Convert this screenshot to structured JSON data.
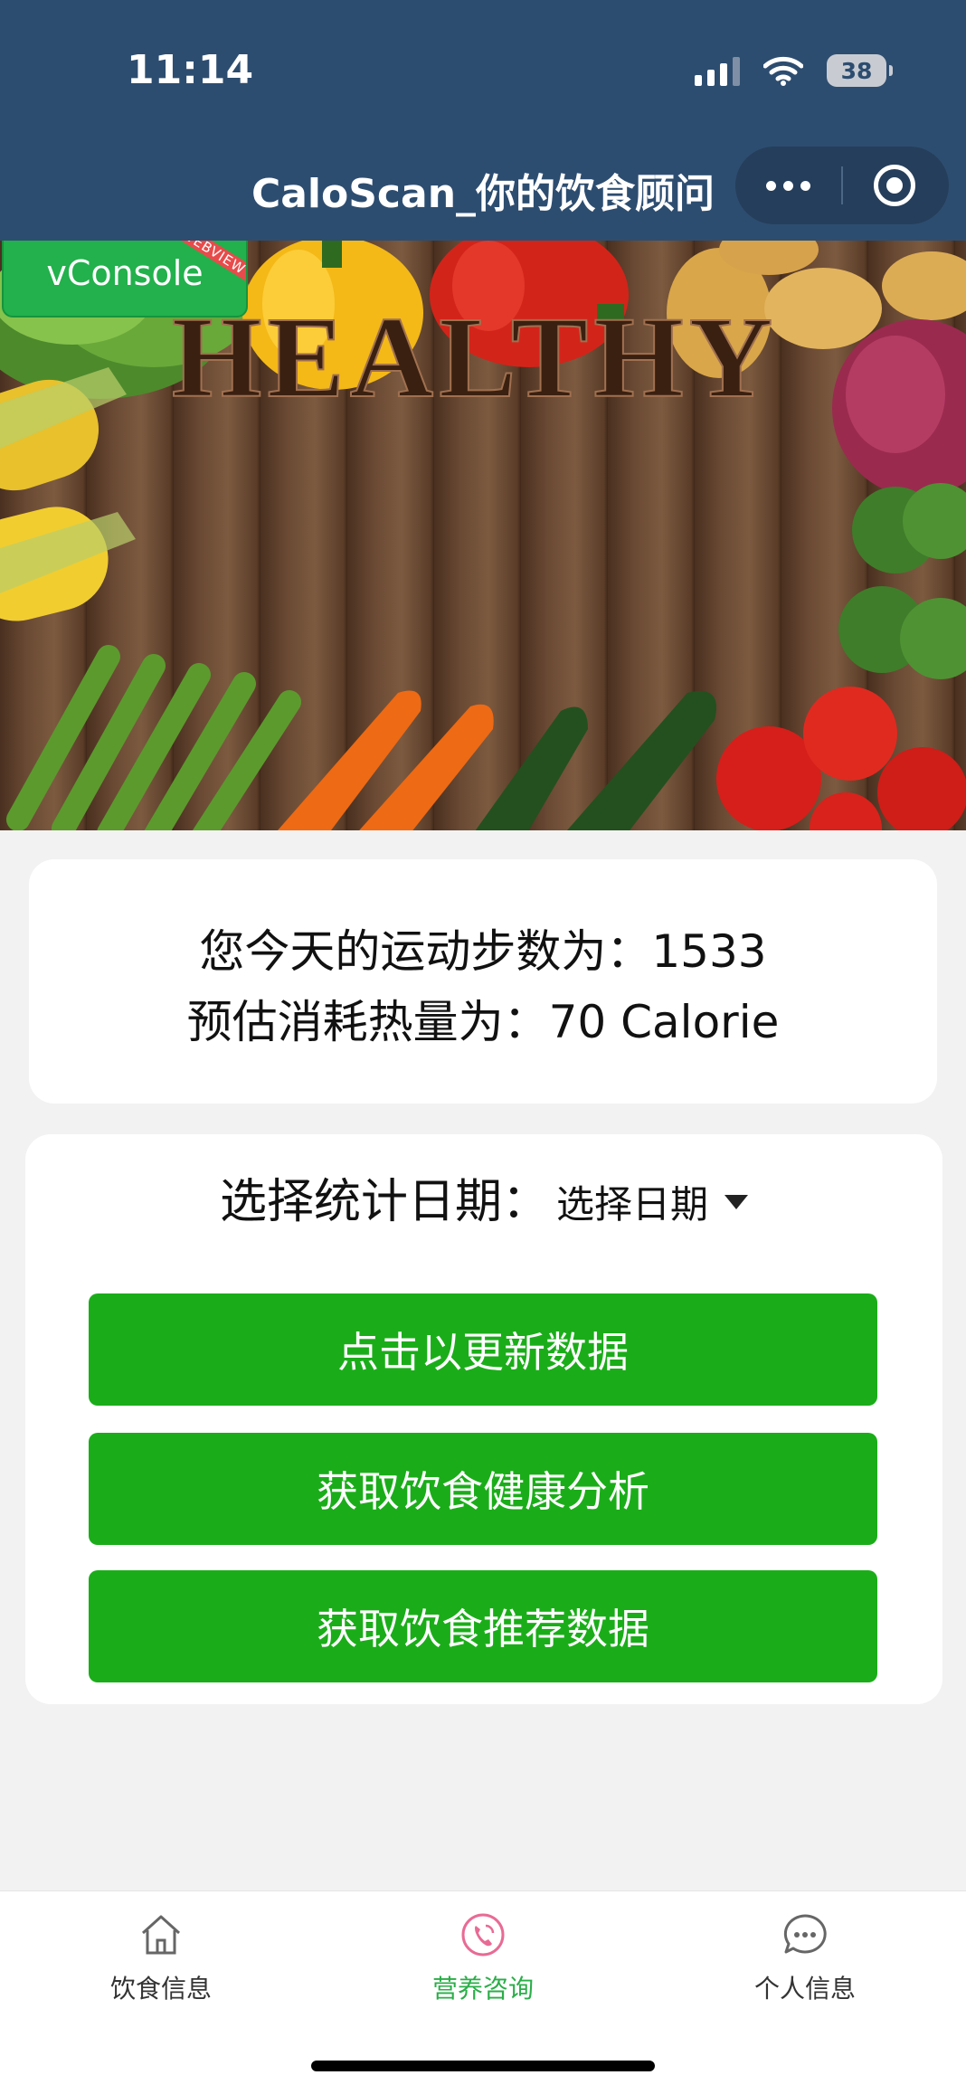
{
  "status_bar": {
    "time": "11:14",
    "battery": "38"
  },
  "nav": {
    "title": "CaloScan_你的饮食顾问"
  },
  "banner": {
    "text": "HEALTHY"
  },
  "vconsole": {
    "label": "vConsole",
    "ribbon": "WEBVIEW"
  },
  "steps": {
    "line1": "您今天的运动步数为：1533",
    "line2": "预估消耗热量为：70 Calorie"
  },
  "date": {
    "label": "选择统计日期：",
    "picker_text": "选择日期"
  },
  "buttons": {
    "update": "点击以更新数据",
    "analysis": "获取饮食健康分析",
    "recommend": "获取饮食推荐数据"
  },
  "tabs": [
    {
      "label": "饮食信息",
      "icon": "home-icon"
    },
    {
      "label": "营养咨询",
      "icon": "phone-icon",
      "active": true
    },
    {
      "label": "个人信息",
      "icon": "chat-icon"
    }
  ],
  "colors": {
    "header": "#2d4d70",
    "button": "#1aad19",
    "tab_active": "#2aae48",
    "vconsole": "#22b14c"
  }
}
